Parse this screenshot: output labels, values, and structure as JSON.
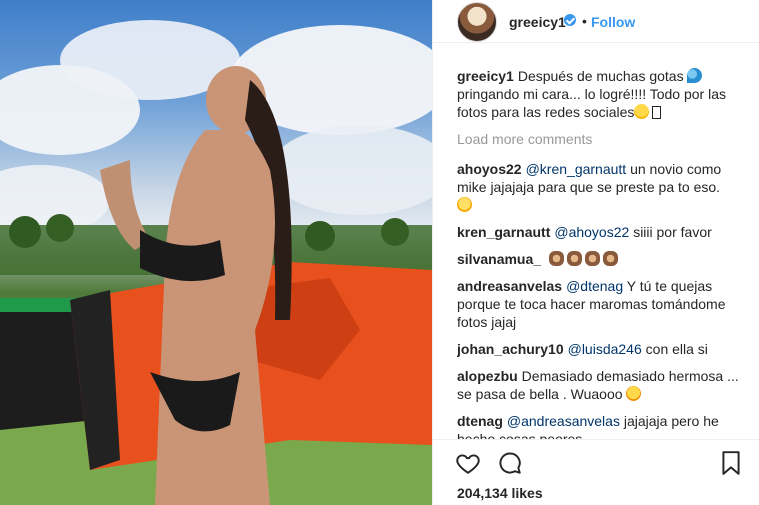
{
  "post": {
    "username": "greeicy1",
    "follow_label": "Follow",
    "separator": "•",
    "likes": "204,134 likes"
  },
  "caption": {
    "username": "greeicy1",
    "text": "Después de muchas gotas",
    "text2": "pringando mi cara... lo logré!!!! Todo por las fotos para las redes sociales"
  },
  "load_more": "Load more comments",
  "comments": [
    {
      "user": "ahoyos22",
      "mention": "@kren_garnautt",
      "text": "un novio como mike jajajaja para que se preste pa to eso."
    },
    {
      "user": "kren_garnautt",
      "mention": "@ahoyos22",
      "text": "siiii por favor"
    },
    {
      "user": "silvanamua_",
      "mention": "",
      "text": ""
    },
    {
      "user": "andreasanvelas",
      "mention": "@dtenag",
      "text": "Y tú te quejas porque te toca hacer maromas tomándome fotos jajaj"
    },
    {
      "user": "johan_achury10",
      "mention": "@luisda246",
      "text": "con ella si"
    },
    {
      "user": "alopezbu",
      "mention": "",
      "text": "Demasiado demasiado hermosa ... se pasa de bella . Wuaooo"
    },
    {
      "user": "dtenag",
      "mention": "@andreasanvelas",
      "text": "jajajaja pero he hecho cosas peores"
    }
  ],
  "icons": {
    "like": "heart-icon",
    "comment": "speech-bubble-icon",
    "save": "bookmark-icon",
    "verified": "verified-badge-icon"
  },
  "colors": {
    "accent": "#3897f0",
    "mention": "#003569",
    "muted": "#999999",
    "text": "#262626"
  }
}
